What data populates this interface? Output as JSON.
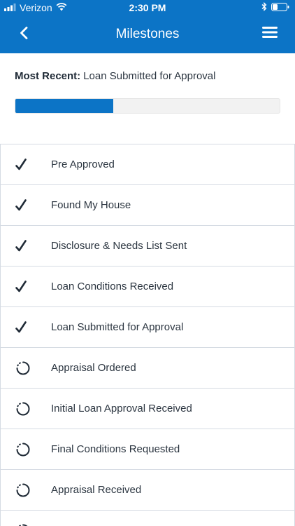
{
  "status_bar": {
    "carrier": "Verizon",
    "time": "2:30 PM"
  },
  "nav": {
    "title": "Milestones",
    "back_icon": "chevron-left-icon",
    "menu_icon": "hamburger-menu-icon"
  },
  "most_recent": {
    "label": "Most Recent:",
    "value": "Loan Submitted for Approval"
  },
  "progress": {
    "fraction": 0.37
  },
  "milestones": [
    {
      "label": "Pre Approved",
      "status": "complete",
      "icon": "checkmark-icon"
    },
    {
      "label": "Found My House",
      "status": "complete",
      "icon": "checkmark-icon"
    },
    {
      "label": "Disclosure & Needs List Sent",
      "status": "complete",
      "icon": "checkmark-icon"
    },
    {
      "label": "Loan Conditions Received",
      "status": "complete",
      "icon": "checkmark-icon"
    },
    {
      "label": "Loan Submitted for Approval",
      "status": "complete",
      "icon": "checkmark-icon"
    },
    {
      "label": "Appraisal Ordered",
      "status": "pending",
      "icon": "pending-spinner-icon"
    },
    {
      "label": "Initial Loan Approval Received",
      "status": "pending",
      "icon": "pending-spinner-icon"
    },
    {
      "label": "Final Conditions Requested",
      "status": "pending",
      "icon": "pending-spinner-icon"
    },
    {
      "label": "Appraisal Received",
      "status": "pending",
      "icon": "pending-spinner-icon"
    },
    {
      "label": "",
      "status": "pending",
      "icon": "pending-spinner-icon"
    }
  ],
  "colors": {
    "brand_blue": "#0c74c6",
    "text_dark": "#27313d",
    "divider": "#d5dbe3"
  }
}
